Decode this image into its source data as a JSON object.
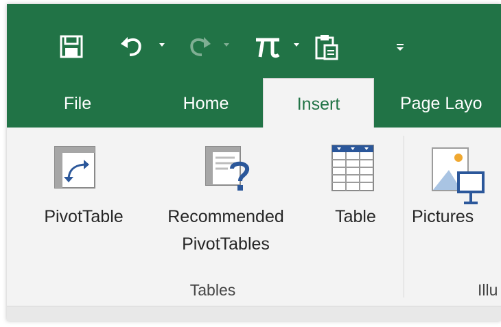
{
  "quick_access": {
    "save": "save-icon",
    "undo": "undo-icon",
    "redo": "redo-icon",
    "equation": "pi-icon",
    "paste": "paste-icon",
    "customize": "customize-qat-icon"
  },
  "tabs": [
    {
      "label": "File"
    },
    {
      "label": "Home"
    },
    {
      "label": "Insert",
      "active": true
    },
    {
      "label": "Page Layo"
    }
  ],
  "ribbon": {
    "pivottable_label": "PivotTable",
    "recommended_line1": "Recommended",
    "recommended_line2": "PivotTables",
    "table_label": "Table",
    "pictures_label": "Pictures",
    "tables_group": "Tables",
    "illustrations_group": "Illu"
  },
  "colors": {
    "accent": "#217346",
    "ribbon_bg": "#f3f3f3",
    "icon_blue": "#2b579a"
  }
}
